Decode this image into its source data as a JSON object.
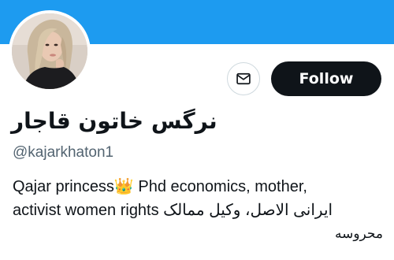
{
  "colors": {
    "banner": "#1d9bf0",
    "follow_button_bg": "#0f1419",
    "secondary_text": "#536471"
  },
  "profile": {
    "display_name": "نرگس خاتون قاجار",
    "handle": "@kajarkhaton1",
    "bio_line_1": "Qajar princess👑 Phd economics, mother,",
    "bio_line_2": "activist women rights ایرانی الاصل، وکیل ممالک",
    "bio_line_3": "محروسه"
  },
  "actions": {
    "message_icon": "envelope-icon",
    "follow_label": "Follow"
  },
  "avatar_icon": "profile-photo"
}
